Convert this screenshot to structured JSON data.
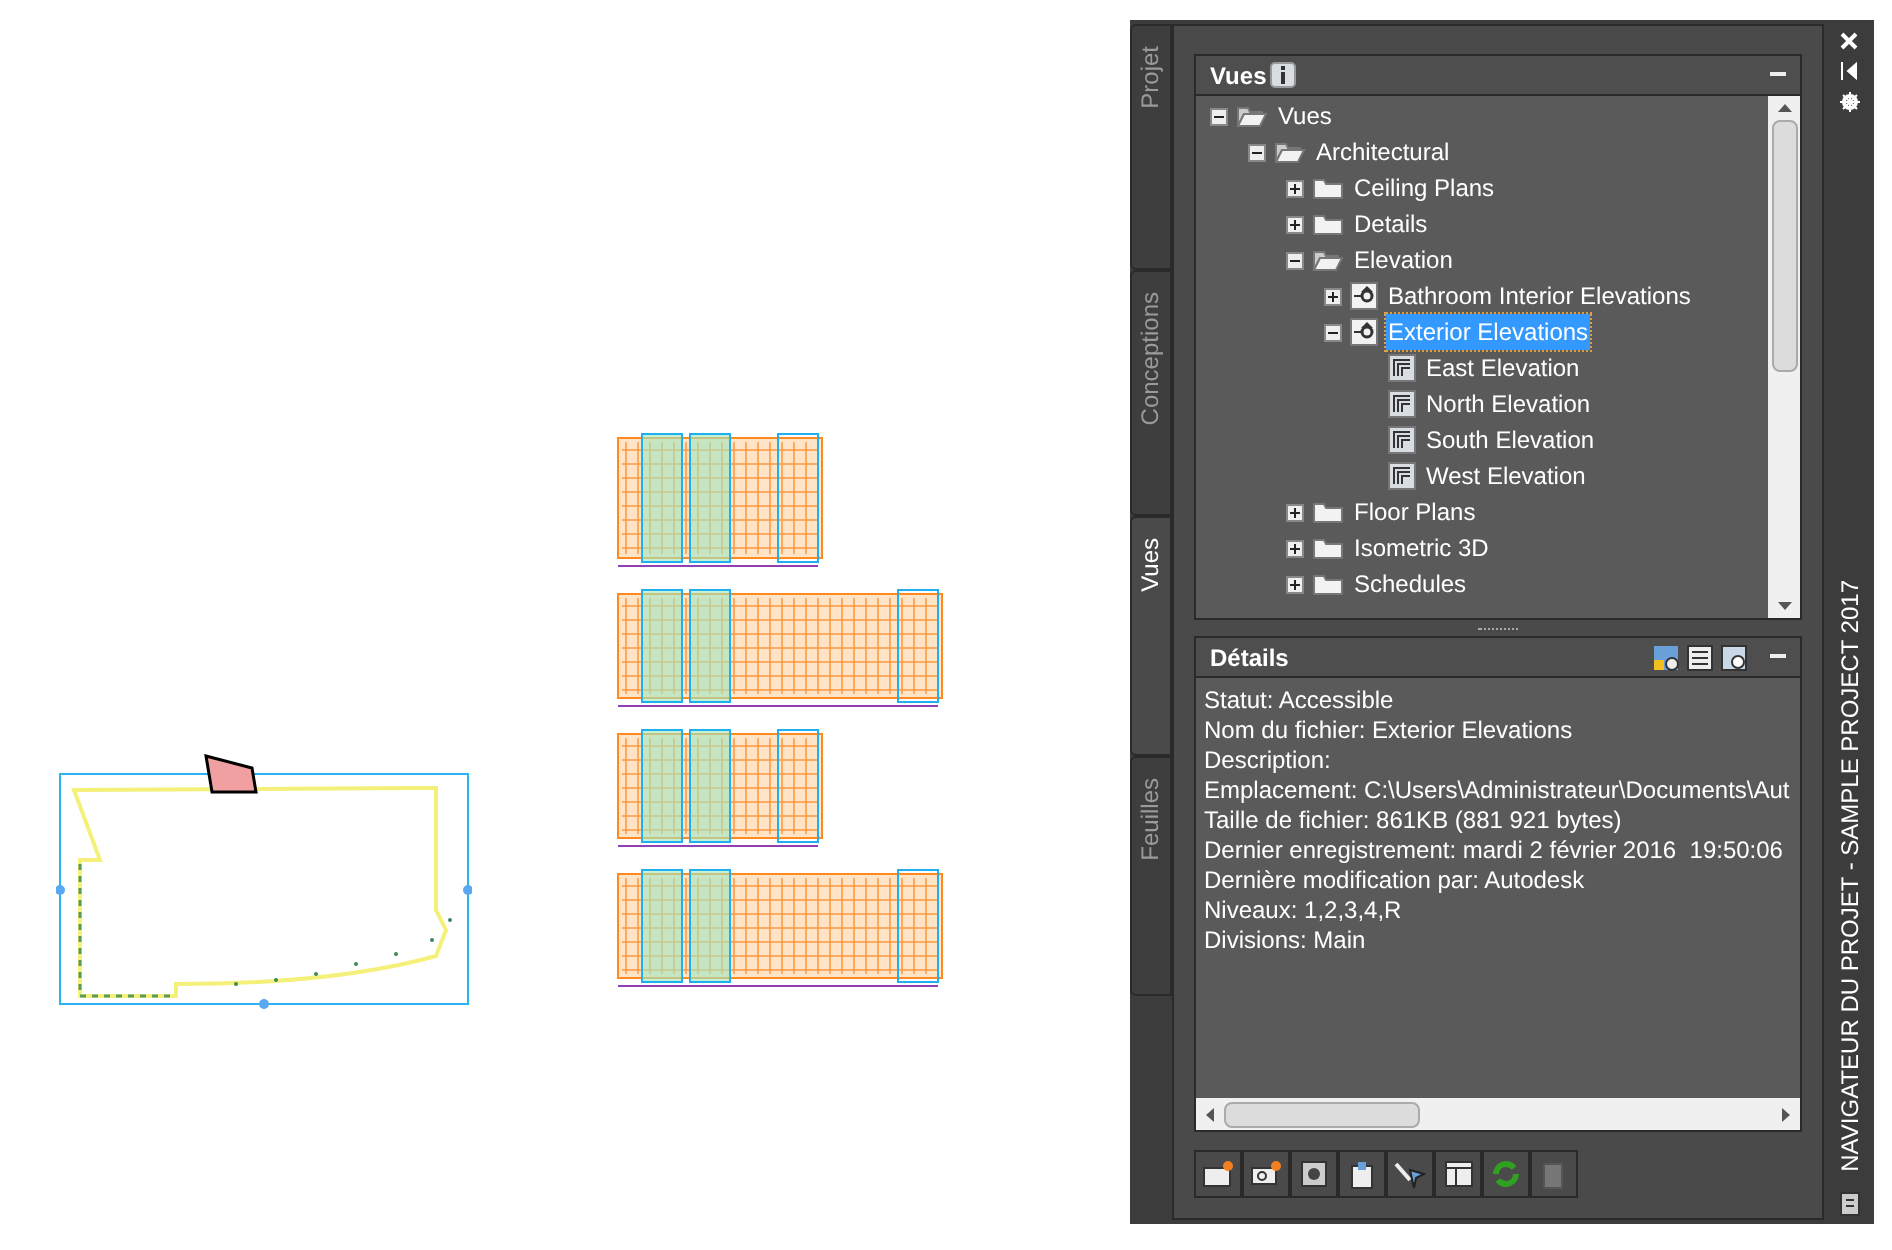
{
  "side_tabs": [
    {
      "label": "Projet",
      "selected": false
    },
    {
      "label": "Conceptions",
      "selected": false
    },
    {
      "label": "Vues",
      "selected": true
    },
    {
      "label": "Feuilles",
      "selected": false
    }
  ],
  "views_panel": {
    "title": "Vues",
    "tree": [
      {
        "label": "Vues",
        "kind": "folder",
        "expanded": true,
        "selected": false,
        "children": [
          {
            "label": "Architectural",
            "kind": "folder",
            "expanded": true,
            "selected": false,
            "children": [
              {
                "label": "Ceiling Plans",
                "kind": "folder",
                "expanded": false,
                "selected": false
              },
              {
                "label": "Details",
                "kind": "folder",
                "expanded": false,
                "selected": false
              },
              {
                "label": "Elevation",
                "kind": "folder",
                "expanded": true,
                "selected": false,
                "children": [
                  {
                    "label": "Bathroom Interior Elevations",
                    "kind": "view",
                    "expanded": false,
                    "selected": false
                  },
                  {
                    "label": "Exterior Elevations",
                    "kind": "view",
                    "expanded": true,
                    "selected": true,
                    "children": [
                      {
                        "label": "East Elevation",
                        "kind": "sheet",
                        "selected": false
                      },
                      {
                        "label": "North Elevation",
                        "kind": "sheet",
                        "selected": false
                      },
                      {
                        "label": "South Elevation",
                        "kind": "sheet",
                        "selected": false
                      },
                      {
                        "label": "West Elevation",
                        "kind": "sheet",
                        "selected": false
                      }
                    ]
                  }
                ]
              },
              {
                "label": "Floor Plans",
                "kind": "folder",
                "expanded": false,
                "selected": false
              },
              {
                "label": "Isometric 3D",
                "kind": "folder",
                "expanded": false,
                "selected": false
              },
              {
                "label": "Schedules",
                "kind": "folder",
                "expanded": false,
                "selected": false
              }
            ]
          }
        ]
      }
    ]
  },
  "details_panel": {
    "title": "Détails",
    "lines": [
      "Statut: Accessible",
      "Nom du fichier: Exterior Elevations",
      "Description:",
      "Emplacement: C:\\Users\\Administrateur\\Documents\\Aut",
      "Taille de fichier: 861KB (881 921 bytes)",
      "Dernier enregistrement: mardi 2 février 2016  19:50:06",
      "Dernière modification par: Autodesk",
      "Niveaux: 1,2,3,4,R",
      "Divisions: Main"
    ]
  },
  "palette_title": "NAVIGATEUR DU PROJET - SAMPLE PROJECT 2017"
}
